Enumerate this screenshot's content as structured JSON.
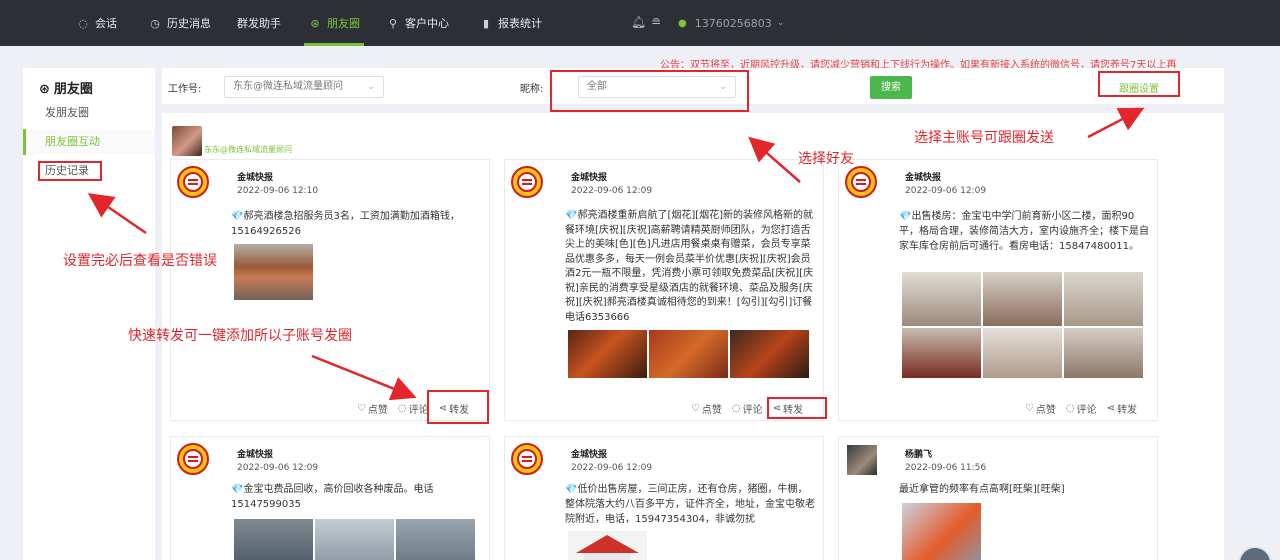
{
  "nav": {
    "items": [
      {
        "label": "会话",
        "icon": "chat-icon"
      },
      {
        "label": "历史消息",
        "icon": "clock-icon"
      },
      {
        "label": "群发助手",
        "icon": ""
      },
      {
        "label": "朋友圈",
        "icon": "aperture-icon"
      },
      {
        "label": "客户中心",
        "icon": "person-icon"
      },
      {
        "label": "报表统计",
        "icon": "bar-chart-icon"
      }
    ],
    "account_phone": "13760256803"
  },
  "notice": "公告：双节将至，近期风控升级，请您减少营销和上下线行为操作。如果有新接入系统的微信号，请您养号7天以上再",
  "sidebar": {
    "title": "朋友圈",
    "items": [
      "发朋友圈",
      "朋友圈互动",
      "历史记录"
    ]
  },
  "filter": {
    "work_label": "工作号:",
    "work_value": "东东@微连私域流量顾问",
    "nickname_label": "昵称:",
    "nickname_value": "全部",
    "search_label": "搜索",
    "follow_label": "跟圈设置"
  },
  "account": {
    "name": "东东@微连私域流量顾问"
  },
  "cards": [
    {
      "name": "金城快报",
      "time": "2022-09-06 12:10",
      "text": "💎郝亮酒楼急招服务员3名，工资加满勤加酒箱钱，15164926526",
      "like": "点赞",
      "comment": "评论",
      "share": "转发"
    },
    {
      "name": "金城快报",
      "time": "2022-09-06 12:09",
      "text": "💎郝亮酒楼重新启航了[烟花][烟花]新的装修风格新的就餐环境[庆祝][庆祝]高薪聘请精英厨师团队，为您打造舌尖上的美味[色][色]凡进店用餐桌桌有赠菜，会员专享菜品优惠多多，每天一例会员菜半价优惠[庆祝][庆祝]会员酒2元一瓶不限量，凭消费小票可领取免费菜品[庆祝][庆祝]亲民的消费享受星级酒店的就餐环境、菜品及服务[庆祝][庆祝]郝亮酒楼真诚相待您的到来！[勾引][勾引]订餐电话6353666",
      "like": "点赞",
      "comment": "评论",
      "share": "转发"
    },
    {
      "name": "金城快报",
      "time": "2022-09-06 12:09",
      "text": "💎出售楼房：金宝屯中学门前育新小区二楼，面积90平，格局合理，装修简洁大方，室内设施齐全；楼下是自家车库仓房前后可通行。看房电话：15847480011。",
      "like": "点赞",
      "comment": "评论",
      "share": "转发"
    },
    {
      "name": "金城快报",
      "time": "2022-09-06 12:09",
      "text": "💎金宝屯费品回收，高价回收各种废品。电话15147599035"
    },
    {
      "name": "金城快报",
      "time": "2022-09-06 12:09",
      "text": "💎低价出售房屋，三间正房，还有仓房，猪圈，牛棚，整体院落大约八百多平方，证件齐全，地址，金宝屯敬老院附近，电话，15947354304，非诚勿扰"
    },
    {
      "name": "杨鹏飞",
      "time": "2022-09-06 11:56",
      "text": "最近拿管的频率有点高啊[旺柴][旺柴]"
    }
  ],
  "annotations": {
    "select_friend": "选择好友",
    "select_main": "选择主账号可跟圈发送",
    "check_errors": "设置完必后查看是否错误",
    "quick_share": "快速转发可一键添加所以子账号发圈"
  },
  "colors": {
    "accent": "#7cc33b",
    "nav_bg": "#2c3036",
    "annotation": "#e2262b",
    "notice": "#e2454a"
  }
}
